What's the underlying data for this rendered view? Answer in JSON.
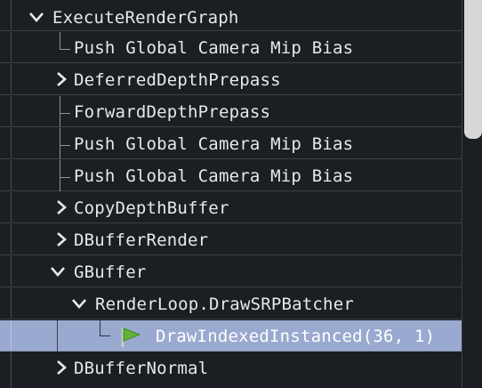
{
  "tree": {
    "rows": [
      {
        "label": "ExecuteRenderGraph",
        "state": "expanded"
      },
      {
        "label": "Push Global Camera Mip Bias",
        "state": "leaf"
      },
      {
        "label": "DeferredDepthPrepass",
        "state": "collapsed"
      },
      {
        "label": "ForwardDepthPrepass",
        "state": "leaf"
      },
      {
        "label": "Push Global Camera Mip Bias",
        "state": "leaf"
      },
      {
        "label": "Push Global Camera Mip Bias",
        "state": "leaf"
      },
      {
        "label": "CopyDepthBuffer",
        "state": "collapsed"
      },
      {
        "label": "DBufferRender",
        "state": "collapsed"
      },
      {
        "label": "GBuffer",
        "state": "expanded"
      },
      {
        "label": "RenderLoop.DrawSRPBatcher",
        "state": "expanded"
      },
      {
        "label": "DrawIndexedInstanced(36, 1)",
        "state": "leaf",
        "selected": true,
        "icon": "green-flag-icon"
      },
      {
        "label": "DBufferNormal",
        "state": "collapsed"
      }
    ]
  },
  "colors": {
    "background": "#1b1f23",
    "selection": "#9aa9cf",
    "flag": "#5fb33a",
    "text": "#e8e8e8"
  }
}
